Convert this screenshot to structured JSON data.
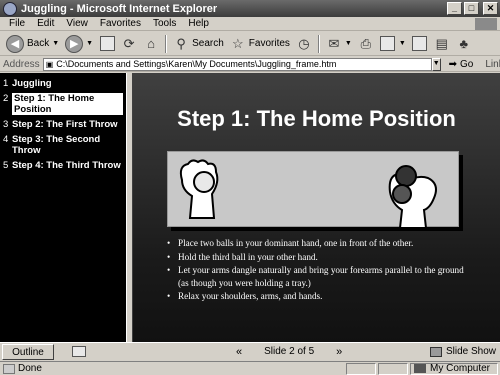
{
  "window": {
    "title": "Juggling - Microsoft Internet Explorer",
    "controls": {
      "minimize": "_",
      "maximize": "□",
      "close": "✕"
    }
  },
  "menubar": {
    "items": [
      "File",
      "Edit",
      "View",
      "Favorites",
      "Tools",
      "Help"
    ]
  },
  "toolbar": {
    "back_label": "Back",
    "search_label": "Search",
    "favorites_label": "Favorites"
  },
  "address": {
    "label": "Address",
    "value": "C:\\Documents and Settings\\Karen\\My Documents\\Juggling_frame.htm",
    "go_label": "Go",
    "links_label": "Links"
  },
  "outline": {
    "items": [
      {
        "num": "1",
        "label": "Juggling"
      },
      {
        "num": "2",
        "label": "Step 1: The Home Position",
        "selected": true
      },
      {
        "num": "3",
        "label": "Step 2: The First Throw"
      },
      {
        "num": "4",
        "label": "Step 3: The Second Throw"
      },
      {
        "num": "5",
        "label": "Step 4: The Third Throw"
      }
    ]
  },
  "slide": {
    "title": "Step 1: The Home Position",
    "bullets": [
      "Place two balls in your dominant hand, one in front of the other.",
      "Hold the third ball in your other hand.",
      "Let your arms dangle naturally and bring your forearms parallel to the ground (as though you were holding a tray.)",
      "Relax your shoulders, arms, and hands."
    ]
  },
  "controls": {
    "outline_tab": "Outline",
    "prev": "«",
    "slide_counter": "Slide 2 of 5",
    "next": "»",
    "slideshow_label": "Slide Show"
  },
  "status": {
    "text": "Done",
    "zone": "My Computer"
  }
}
